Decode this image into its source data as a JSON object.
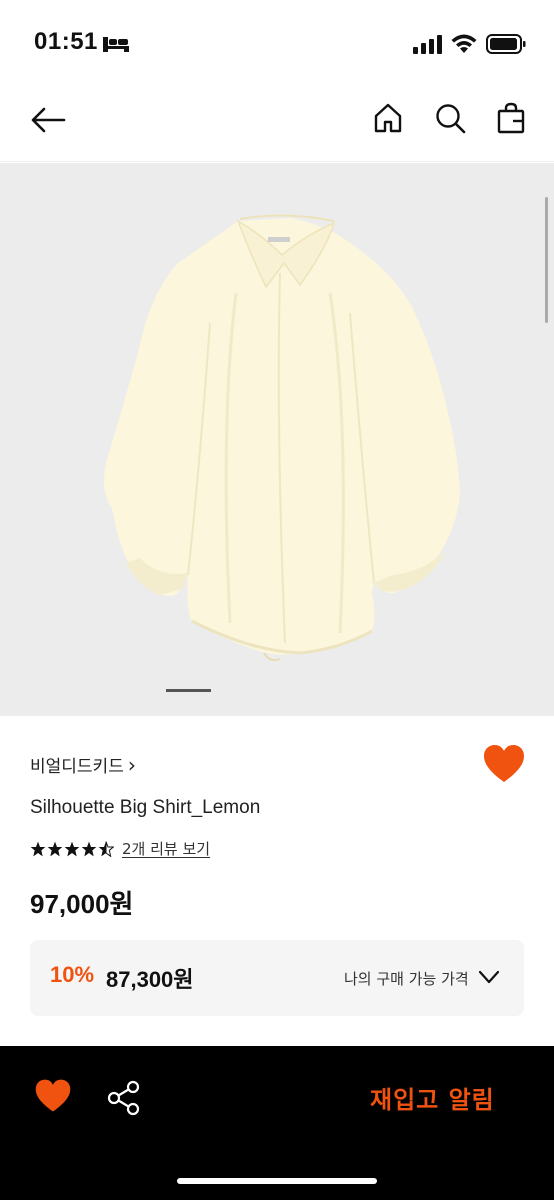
{
  "status_bar": {
    "time": "01:51",
    "icons": [
      "sleep-icon",
      "cellular-signal-icon",
      "wifi-icon",
      "battery-icon"
    ]
  },
  "nav": {
    "icons": [
      "back-arrow-icon",
      "home-icon",
      "search-icon",
      "shopping-bag-icon"
    ]
  },
  "product": {
    "image_alt": "shirt-photo",
    "brand": "비얼디드키드",
    "brand_chevron": "›",
    "name": "Silhouette Big Shirt_Lemon",
    "rating": 4.5,
    "rating_max": 5,
    "review_link": "2개 리뷰 보기",
    "price": "97,000원",
    "my_price": {
      "discount_rate": "10%",
      "discount_price": "87,300원",
      "label": "나의 구매 가능 가격"
    },
    "wishlisted": true
  },
  "bottom_bar": {
    "restock_label": "재입고 알림"
  },
  "colors": {
    "accent": "#f0520f",
    "image_bg": "#ececec",
    "shirt": "#fbf6dc",
    "box_bg": "#f5f5f5"
  }
}
